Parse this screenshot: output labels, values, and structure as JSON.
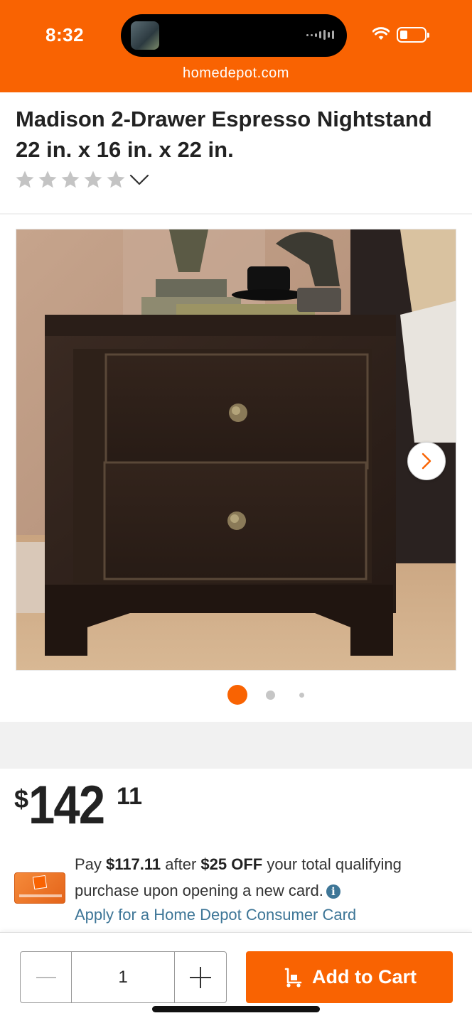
{
  "status_bar": {
    "time": "8:32",
    "url": "homedepot.com"
  },
  "product": {
    "title": "Madison 2-Drawer Espresso Nightstand 22 in. x 16 in. x 22 in.",
    "rating_stars": 0,
    "image_count": 3,
    "active_image": 1
  },
  "price": {
    "currency": "$",
    "dollars": "142",
    "cents": "11"
  },
  "promo": {
    "text_1": "Pay ",
    "amount_after": "$117.11",
    "text_2": " after ",
    "discount": "$25 OFF",
    "text_3": " your total qualifying purchase upon opening a new card.",
    "info_glyph": "i",
    "apply_link": "Apply for a Home Depot Consumer Card"
  },
  "cart": {
    "quantity": "1",
    "add_to_cart_label": "Add to Cart"
  },
  "colors": {
    "brand": "#f96302",
    "link": "#3e7697",
    "star_empty": "#c4c4c4"
  }
}
